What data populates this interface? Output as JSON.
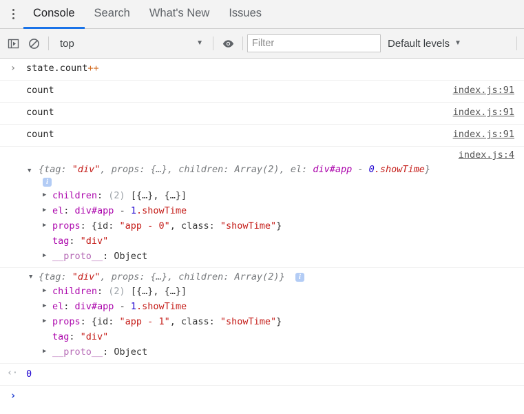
{
  "tabs": [
    {
      "label": "Console",
      "active": true
    },
    {
      "label": "Search",
      "active": false
    },
    {
      "label": "What's New",
      "active": false
    },
    {
      "label": "Issues",
      "active": false
    }
  ],
  "toolbar": {
    "sidebar_toggle_icon": "show-console-sidebar-icon",
    "clear_icon": "clear-console-icon",
    "context_value": "top",
    "context_caret": "▼",
    "eye_icon": "live-expression-eye-icon",
    "filter_placeholder": "Filter",
    "filter_value": "",
    "levels_label": "Default levels",
    "levels_caret": "▼"
  },
  "console": {
    "input_row": {
      "prompt": "›",
      "code_main": "state.count",
      "code_op": "++"
    },
    "log_rows": [
      {
        "text": "count",
        "source": "index.js:91"
      },
      {
        "text": "count",
        "source": "index.js:91"
      },
      {
        "text": "count",
        "source": "index.js:91"
      }
    ],
    "groups": [
      {
        "source": "index.js:4",
        "expanded_triangle": "▼",
        "collapsed_triangle": "▶",
        "preview": {
          "open": "{",
          "k_tag": "tag: ",
          "v_tag": "\"div\"",
          "sep1": ", ",
          "k_props": "props: ",
          "v_props": "{…}",
          "sep2": ", ",
          "k_children": "children: ",
          "v_children": "Array(2)",
          "sep3": ", ",
          "k_el": "el: ",
          "v_el_tag": "div#app",
          "v_el_dash": " - ",
          "v_el_num": "0",
          "v_el_name": ".showTime",
          "close": "}"
        },
        "info_badge": "i",
        "props": [
          {
            "expandable": true,
            "name": "children",
            "sep": ": ",
            "count": "(2)",
            "value": " [{…}, {…}]"
          },
          {
            "expandable": true,
            "name": "el",
            "sep": ": ",
            "el_tag": "div#app",
            "el_dash": " - ",
            "el_num": "1",
            "el_name": ".showTime"
          },
          {
            "expandable": true,
            "name": "props",
            "sep": ": ",
            "obj_open": "{id: ",
            "obj_id": "\"app - 0\"",
            "obj_mid": ", class: ",
            "obj_class": "\"showTime\"",
            "obj_close": "}"
          },
          {
            "expandable": false,
            "name": "tag",
            "sep": ": ",
            "value_str": "\"div\""
          },
          {
            "expandable": true,
            "name": "__proto__",
            "sep": ": ",
            "value_plain": "Object"
          }
        ]
      },
      {
        "source": "",
        "expanded_triangle": "▼",
        "collapsed_triangle": "▶",
        "preview": {
          "open": "{",
          "k_tag": "tag: ",
          "v_tag": "\"div\"",
          "sep1": ", ",
          "k_props": "props: ",
          "v_props": "{…}",
          "sep2": ", ",
          "k_children": "children: ",
          "v_children": "Array(2)",
          "sep3": "",
          "k_el": "",
          "v_el_tag": "",
          "v_el_dash": "",
          "v_el_num": "",
          "v_el_name": "",
          "close": "}"
        },
        "info_badge": "i",
        "props": [
          {
            "expandable": true,
            "name": "children",
            "sep": ": ",
            "count": "(2)",
            "value": " [{…}, {…}]"
          },
          {
            "expandable": true,
            "name": "el",
            "sep": ": ",
            "el_tag": "div#app",
            "el_dash": " - ",
            "el_num": "1",
            "el_name": ".showTime"
          },
          {
            "expandable": true,
            "name": "props",
            "sep": ": ",
            "obj_open": "{id: ",
            "obj_id": "\"app - 1\"",
            "obj_mid": ", class: ",
            "obj_class": "\"showTime\"",
            "obj_close": "}"
          },
          {
            "expandable": false,
            "name": "tag",
            "sep": ": ",
            "value_str": "\"div\""
          },
          {
            "expandable": true,
            "name": "__proto__",
            "sep": ": ",
            "value_plain": "Object"
          }
        ]
      }
    ],
    "result_row": {
      "arrow": "‹·",
      "value": "0"
    },
    "prompt_row": {
      "prompt": "›"
    }
  },
  "colors": {
    "accent": "#1a73e8",
    "string": "#c41a16",
    "number": "#1c00cf",
    "property": "#ad0aad",
    "preview_text": "#76797c",
    "toolbar_bg": "#f3f3f3"
  }
}
